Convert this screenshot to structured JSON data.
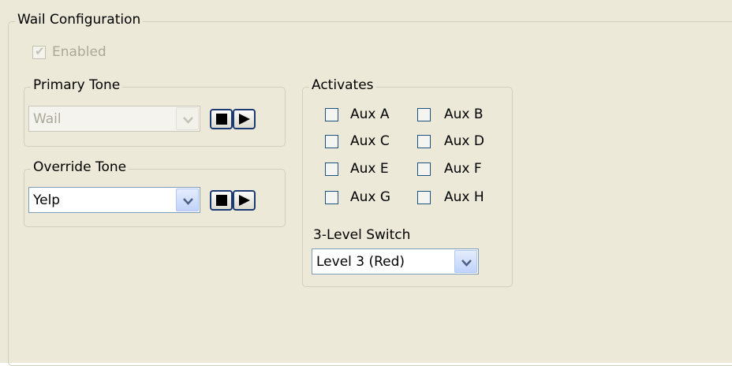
{
  "wail_config": {
    "title": "Wail Configuration",
    "enabled": {
      "label": "Enabled",
      "checked": true,
      "disabled": true
    }
  },
  "primary_tone": {
    "title": "Primary Tone",
    "value": "Wail",
    "disabled": true,
    "stop_icon": "stop-icon",
    "play_icon": "play-icon"
  },
  "override_tone": {
    "title": "Override Tone",
    "value": "Yelp",
    "stop_icon": "stop-icon",
    "play_icon": "play-icon"
  },
  "activates": {
    "title": "Activates",
    "aux": [
      {
        "label": "Aux A",
        "checked": false
      },
      {
        "label": "Aux B",
        "checked": false
      },
      {
        "label": "Aux C",
        "checked": false
      },
      {
        "label": "Aux D",
        "checked": false
      },
      {
        "label": "Aux E",
        "checked": false
      },
      {
        "label": "Aux F",
        "checked": false
      },
      {
        "label": "Aux G",
        "checked": false
      },
      {
        "label": "Aux H",
        "checked": false
      }
    ],
    "switch_label": "3-Level Switch",
    "switch_value": "Level 3 (Red)"
  },
  "colors": {
    "panel_bg": "#ece9d8",
    "group_border": "#d0d0bf",
    "combo_border": "#7f9db9",
    "button_border": "#1c3b73"
  }
}
